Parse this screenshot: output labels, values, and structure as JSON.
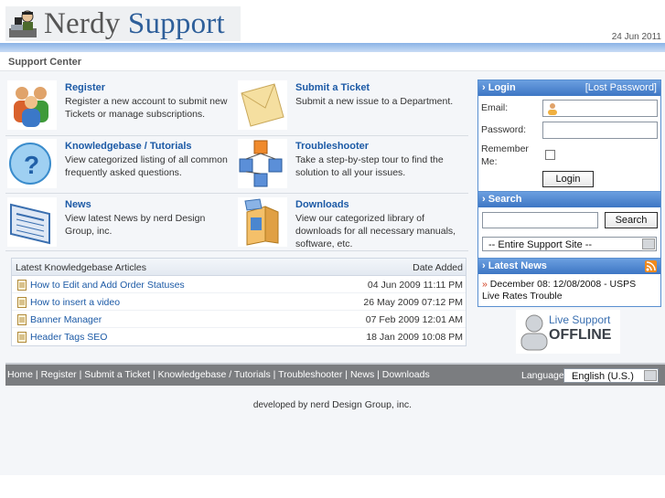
{
  "header": {
    "brand_part1": "Nerdy",
    "brand_part2": "Support",
    "date": "24 Jun 2011"
  },
  "subheader": {
    "title": "Support Center"
  },
  "sections": [
    {
      "title": "Register",
      "desc": "Register a new account to submit new Tickets or manage subscriptions.",
      "icon": "users-icon"
    },
    {
      "title": "Submit a Ticket",
      "desc": "Submit a new issue to a Department.",
      "icon": "envelope-icon"
    },
    {
      "title": "Knowledgebase / Tutorials",
      "desc": "View categorized listing of all common frequently asked questions.",
      "icon": "help-icon"
    },
    {
      "title": "Troubleshooter",
      "desc": "Take a step-by-step tour to find the solution to all your issues.",
      "icon": "flowchart-icon"
    },
    {
      "title": "News",
      "desc": "View latest News by nerd Design Group, inc.",
      "icon": "newspaper-icon"
    },
    {
      "title": "Downloads",
      "desc": "View our categorized library of downloads for all necessary manuals, software, etc.",
      "icon": "box-icon"
    }
  ],
  "articles": {
    "header_left": "Latest Knowledgebase Articles",
    "header_right": "Date Added",
    "rows": [
      {
        "title": "How to Edit and Add Order Statuses",
        "date": "04 Jun 2009 11:11 PM"
      },
      {
        "title": "How to insert a video",
        "date": "26 May 2009 07:12 PM"
      },
      {
        "title": "Banner Manager",
        "date": "07 Feb 2009 12:01 AM"
      },
      {
        "title": "Header Tags SEO",
        "date": "18 Jan 2009 10:08 PM"
      }
    ]
  },
  "login": {
    "title": "Login",
    "lost_password": "[Lost Password]",
    "email_label": "Email:",
    "password_label": "Password:",
    "remember_label": "Remember Me:",
    "button": "Login"
  },
  "search": {
    "title": "Search",
    "button": "Search",
    "scope": "-- Entire Support Site --"
  },
  "news": {
    "title": "Latest News",
    "item_bullet": "»",
    "item": "December 08: 12/08/2008 - USPS Live Rates Trouble"
  },
  "live_support": {
    "line1": "Live Support",
    "line2": "OFFLINE"
  },
  "footer": {
    "nav": [
      "Home",
      "Register",
      "Submit a Ticket",
      "Knowledgebase / Tutorials",
      "Troubleshooter",
      "News",
      "Downloads"
    ],
    "separator": " | ",
    "language_label": "Language:",
    "language_value": "English (U.S.)",
    "developed_by": "developed by",
    "company": "nerd Design Group, inc."
  },
  "colors": {
    "link": "#1c5aa6",
    "accent": "#3d76c4",
    "footer_bg": "#7b7d80"
  }
}
